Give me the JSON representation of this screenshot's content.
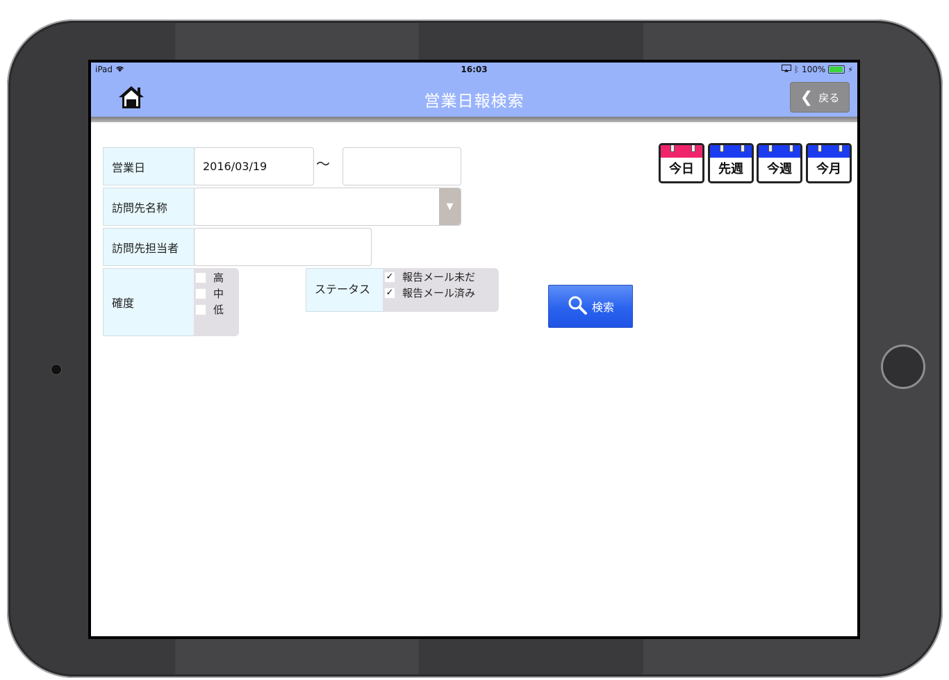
{
  "status": {
    "device": "iPad",
    "time": "16:03",
    "battery": "100%",
    "battery_level": 1.0
  },
  "header": {
    "title": "営業日報検索",
    "back_label": "戻る"
  },
  "form": {
    "business_day_label": "営業日",
    "date_from": "2016/03/19",
    "date_to": "",
    "range_separator": "〜",
    "visit_name_label": "訪問先名称",
    "visit_name_value": "",
    "contact_label": "訪問先担当者",
    "contact_value": "",
    "certainty_label": "確度",
    "certainty_options": [
      {
        "label": "高",
        "checked": false
      },
      {
        "label": "中",
        "checked": false
      },
      {
        "label": "低",
        "checked": false
      }
    ],
    "status_label": "ステータス",
    "status_options": [
      {
        "label": "報告メール未だ",
        "checked": true
      },
      {
        "label": "報告メール済み",
        "checked": true
      }
    ],
    "search_label": "検索"
  },
  "calendar_buttons": [
    {
      "label": "今日",
      "color": "#f0246c"
    },
    {
      "label": "先週",
      "color": "#1c3cf2"
    },
    {
      "label": "今週",
      "color": "#1c3cf2"
    },
    {
      "label": "今月",
      "color": "#1c3cf2"
    }
  ],
  "colors": {
    "navbar": "#99b3fb",
    "label_bg": "#e7f8fe",
    "search_button": "#2a63ee"
  }
}
